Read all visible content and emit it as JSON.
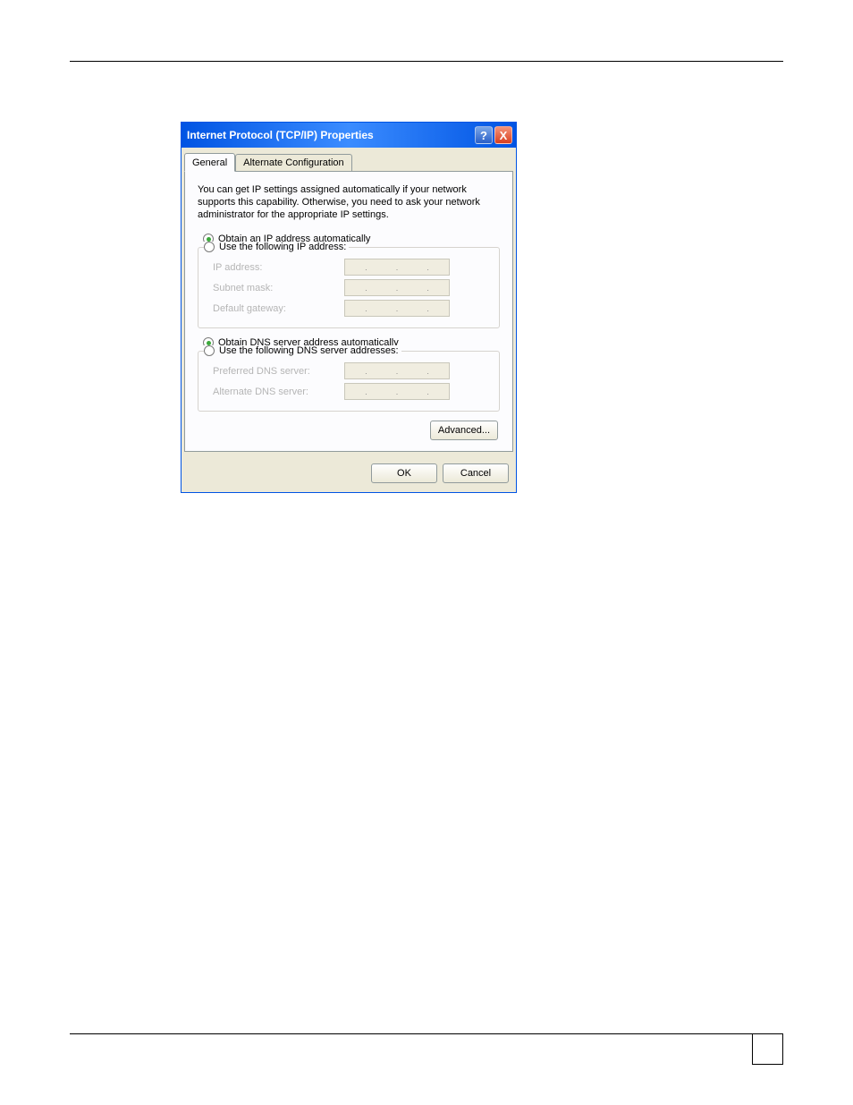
{
  "dialog": {
    "title": "Internet Protocol (TCP/IP) Properties",
    "tabs": {
      "general": "General",
      "alternate": "Alternate Configuration"
    },
    "description": "You can get IP settings assigned automatically if your network supports this capability. Otherwise, you need to ask your network administrator for the appropriate IP settings.",
    "ip_group": {
      "auto": "Obtain an IP address automatically",
      "manual": "Use the following IP address:",
      "ip_label": "IP address:",
      "subnet_label": "Subnet mask:",
      "gateway_label": "Default gateway:"
    },
    "dns_group": {
      "auto": "Obtain DNS server address automatically",
      "manual": "Use the following DNS server addresses:",
      "preferred_label": "Preferred DNS server:",
      "alternate_label": "Alternate DNS server:"
    },
    "buttons": {
      "advanced": "Advanced...",
      "ok": "OK",
      "cancel": "Cancel"
    },
    "ip_dot": ".",
    "titlebar": {
      "help": "?",
      "close": "X"
    }
  }
}
